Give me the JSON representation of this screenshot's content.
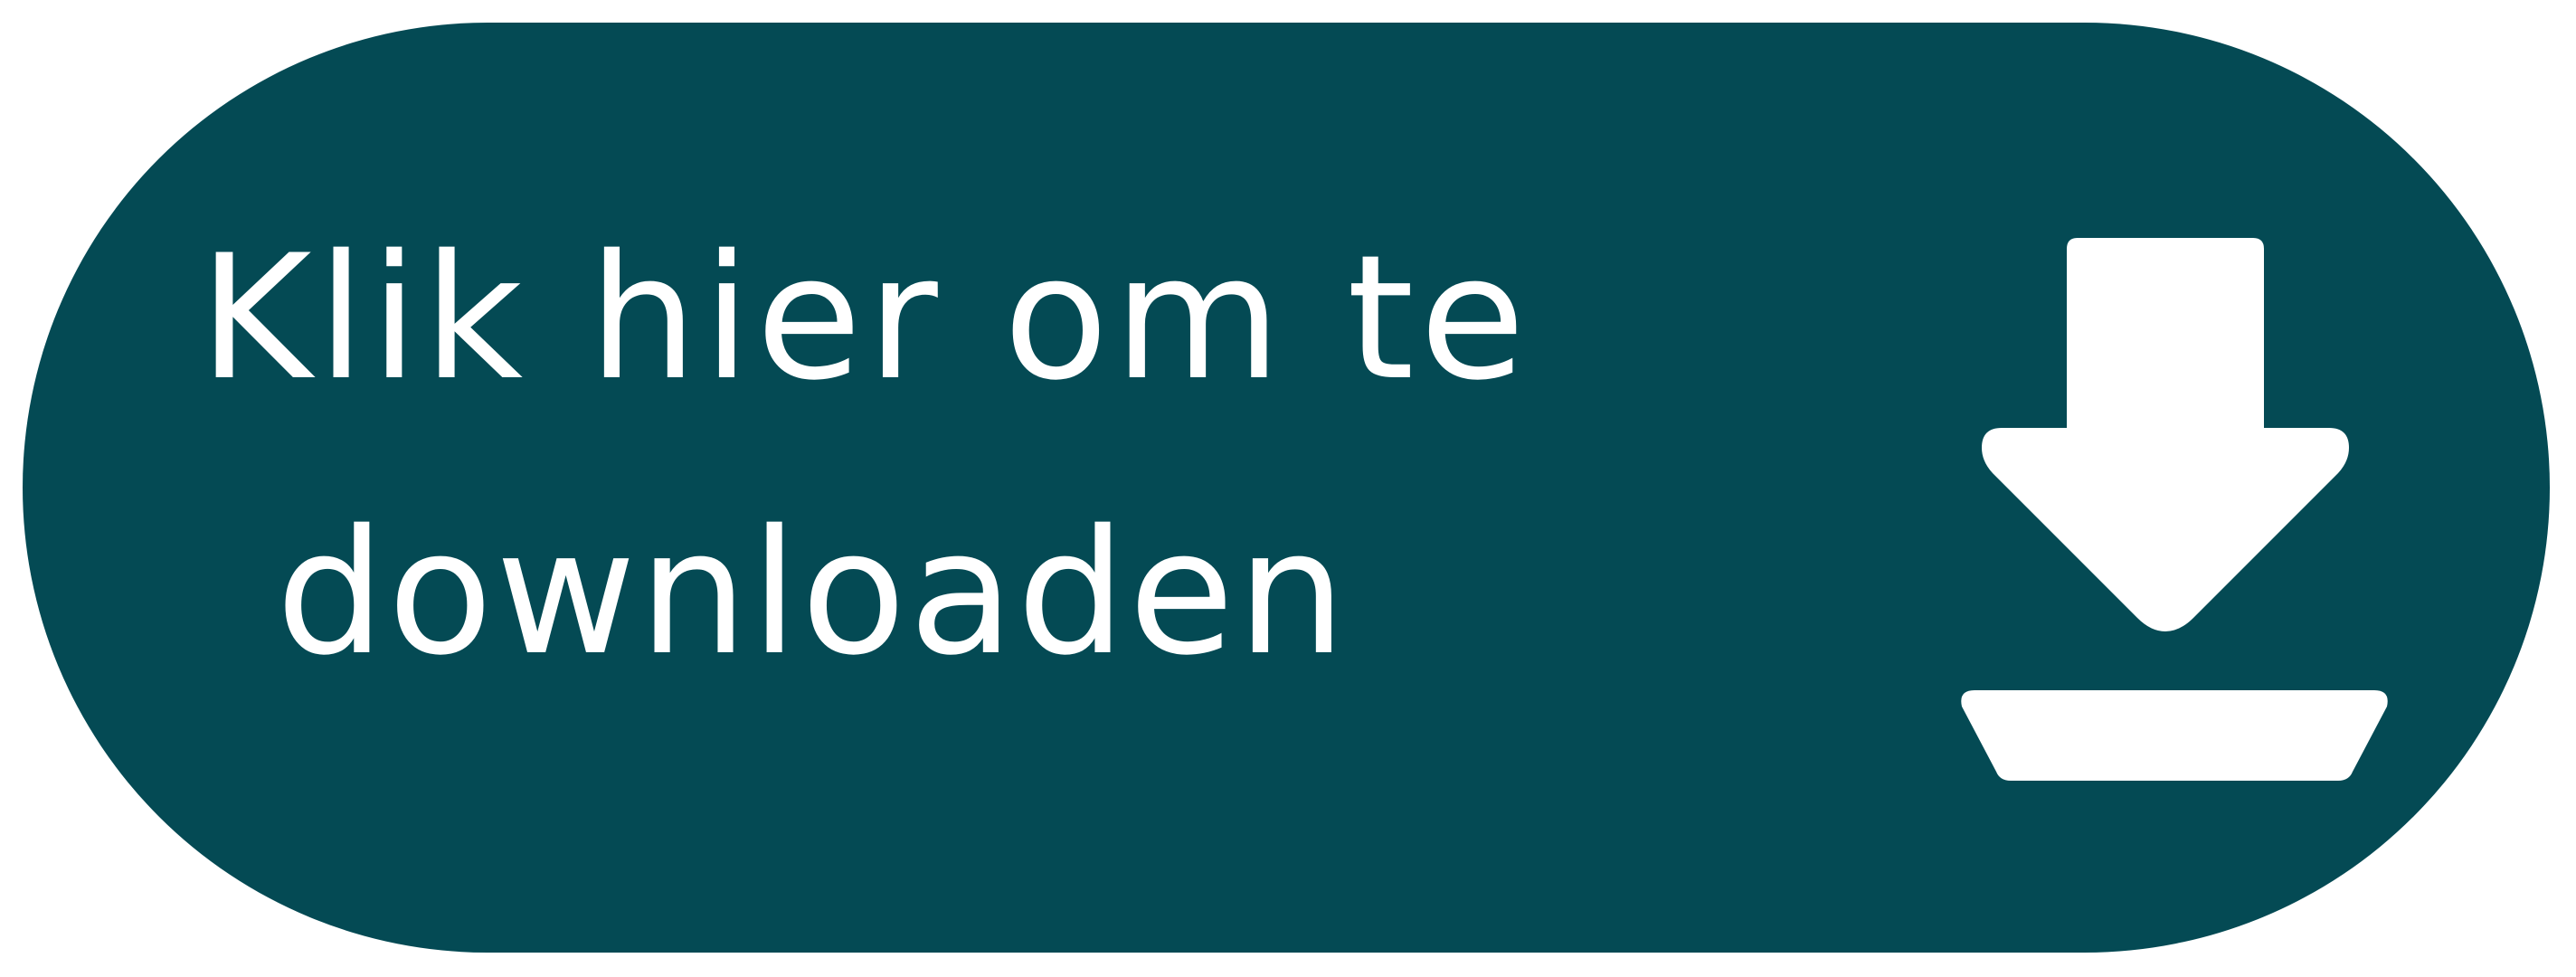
{
  "button": {
    "line1": "Klik hier om te",
    "line2": "downloaden",
    "icon": "download-icon"
  },
  "colors": {
    "background": "#044a54",
    "foreground": "#ffffff"
  }
}
